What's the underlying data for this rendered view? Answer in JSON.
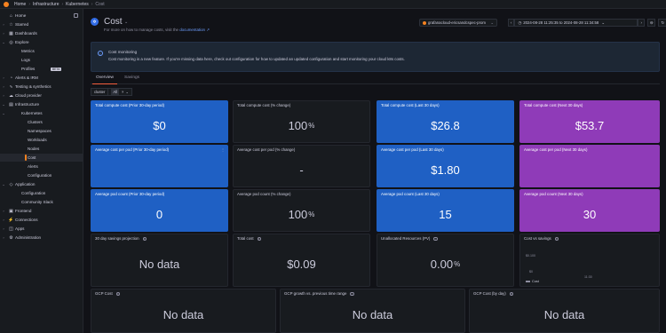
{
  "breadcrumbs": [
    "Home",
    "Infrastructure",
    "Kubernetes",
    "Cost"
  ],
  "sidebar": {
    "items": [
      {
        "label": "Home",
        "icon": "home-icon",
        "chev": ""
      },
      {
        "label": "Starred",
        "icon": "star-icon",
        "chev": ">"
      },
      {
        "label": "Dashboards",
        "icon": "dashboards-icon",
        "chev": ">"
      },
      {
        "label": "Explore",
        "icon": "compass-icon",
        "chev": "v"
      },
      {
        "label": "Metrics",
        "icon": "",
        "chev": ""
      },
      {
        "label": "Logs",
        "icon": "",
        "chev": ""
      },
      {
        "label": "Profiles",
        "icon": "",
        "chev": "",
        "badge": "BETA"
      },
      {
        "label": "Alerts & IRM",
        "icon": "bell-icon",
        "chev": ">"
      },
      {
        "label": "Testing & synthetics",
        "icon": "pulse-icon",
        "chev": ">"
      },
      {
        "label": "Cloud provider",
        "icon": "cloud-icon",
        "chev": ">"
      },
      {
        "label": "Infrastructure",
        "icon": "server-icon",
        "chev": "v"
      },
      {
        "label": "Kubernetes",
        "icon": "",
        "chev": "v"
      },
      {
        "label": "Clusters",
        "icon": "",
        "chev": ""
      },
      {
        "label": "Namespaces",
        "icon": "",
        "chev": ""
      },
      {
        "label": "Workloads",
        "icon": "",
        "chev": ""
      },
      {
        "label": "Nodes",
        "icon": "",
        "chev": ""
      },
      {
        "label": "Cost",
        "icon": "",
        "chev": "",
        "active": true
      },
      {
        "label": "Alerts",
        "icon": "",
        "chev": ""
      },
      {
        "label": "Configuration",
        "icon": "",
        "chev": ""
      },
      {
        "label": "Application",
        "icon": "app-icon",
        "chev": "v"
      },
      {
        "label": "Configuration",
        "icon": "",
        "chev": ""
      },
      {
        "label": "Community Slack",
        "icon": "",
        "chev": ""
      },
      {
        "label": "Frontend",
        "icon": "frontend-icon",
        "chev": ">"
      },
      {
        "label": "Connections",
        "icon": "plug-icon",
        "chev": ">"
      },
      {
        "label": "Apps",
        "icon": "apps-icon",
        "chev": ">"
      },
      {
        "label": "Administration",
        "icon": "gear-icon",
        "chev": ">"
      }
    ]
  },
  "header": {
    "title": "Cost",
    "subtitle_prefix": "For more on how to manage costs, visit the",
    "subtitle_link": "documentation",
    "datasource": "grafanacloud-ericsandcspec-prom",
    "time_range": "2024-08-28 11:25:35 to 2024-08-28 11:34:58"
  },
  "banner": {
    "title": "Cost monitoring",
    "body": "Cost monitoring is a new feature. If you're missing data here, check out configuration for how to updated an updated configuration and start monitoring your cloud k8s costs."
  },
  "tabs": [
    {
      "label": "Overview",
      "active": true
    },
    {
      "label": "Savings",
      "active": false
    }
  ],
  "filter": {
    "label": "cluster",
    "value": "All"
  },
  "panels": [
    {
      "title": "Total compute cost (Prior 30-day period)",
      "value": "$0",
      "unit": "",
      "color": "blue"
    },
    {
      "title": "Total compute cost (% change)",
      "value": "100",
      "unit": "%",
      "color": "dark"
    },
    {
      "title": "Total compute cost (Last 30 days)",
      "value": "$26.8",
      "unit": "",
      "color": "blue"
    },
    {
      "title": "Total compute cost (Next 30 days)",
      "value": "$53.7",
      "unit": "",
      "color": "purple"
    },
    {
      "title": "Average cost per pod (Prior 30-day period)",
      "value": "",
      "unit": "",
      "color": "blue"
    },
    {
      "title": "Average cost per pod (% change)",
      "value": "-",
      "unit": "",
      "color": "dark"
    },
    {
      "title": "Average cost per pod (Last 30 days)",
      "value": "$1.80",
      "unit": "",
      "color": "blue"
    },
    {
      "title": "Average cost per pod (Next 30 days)",
      "value": "",
      "unit": "",
      "color": "purple"
    },
    {
      "title": "Average pod count (Prior 30-day period)",
      "value": "0",
      "unit": "",
      "color": "blue"
    },
    {
      "title": "Average pod count (% change)",
      "value": "100",
      "unit": "%",
      "color": "dark"
    },
    {
      "title": "Average pod count (Last 30 days)",
      "value": "15",
      "unit": "",
      "color": "blue"
    },
    {
      "title": "Average pod count (Next 30 days)",
      "value": "30",
      "unit": "",
      "color": "purple"
    },
    {
      "title": "30 day savings projection",
      "value": "No data",
      "unit": "",
      "color": "dark"
    },
    {
      "title": "Total cost",
      "value": "$0.09",
      "unit": "",
      "color": "dark"
    },
    {
      "title": "Unallocated Resources (PV)",
      "value": "0.00",
      "unit": "%",
      "color": "dark"
    },
    {
      "title": "Cost vs savings",
      "value": "",
      "unit": "",
      "color": "dark"
    },
    {
      "title": "GCP Cost",
      "value": "No data",
      "unit": "",
      "color": "dark"
    },
    {
      "title": "GCP growth vs. previous time range",
      "value": "No data",
      "unit": "",
      "color": "dark"
    },
    {
      "title": "GCP Cost (by day)",
      "value": "No data",
      "unit": "",
      "color": "dark"
    }
  ],
  "cost_chart": {
    "yticks": [
      "$0.100",
      "$0"
    ],
    "xtick": "11:30",
    "legend": "Cost"
  },
  "colors": {
    "blue": "#1f60c4",
    "purple": "#8f3bb8",
    "accent": "#f55f3e"
  }
}
